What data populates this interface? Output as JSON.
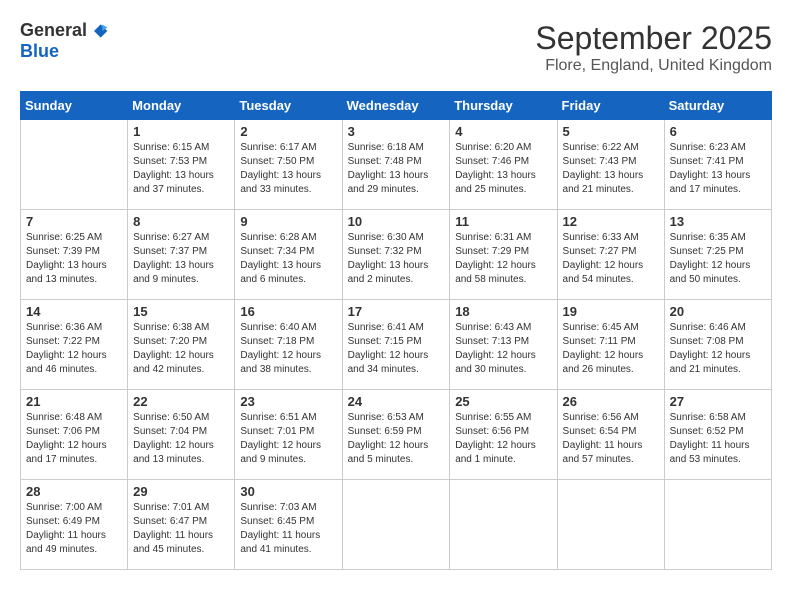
{
  "logo": {
    "general": "General",
    "blue": "Blue"
  },
  "title": "September 2025",
  "location": "Flore, England, United Kingdom",
  "days_header": [
    "Sunday",
    "Monday",
    "Tuesday",
    "Wednesday",
    "Thursday",
    "Friday",
    "Saturday"
  ],
  "weeks": [
    [
      {
        "day": "",
        "info": ""
      },
      {
        "day": "1",
        "info": "Sunrise: 6:15 AM\nSunset: 7:53 PM\nDaylight: 13 hours\nand 37 minutes."
      },
      {
        "day": "2",
        "info": "Sunrise: 6:17 AM\nSunset: 7:50 PM\nDaylight: 13 hours\nand 33 minutes."
      },
      {
        "day": "3",
        "info": "Sunrise: 6:18 AM\nSunset: 7:48 PM\nDaylight: 13 hours\nand 29 minutes."
      },
      {
        "day": "4",
        "info": "Sunrise: 6:20 AM\nSunset: 7:46 PM\nDaylight: 13 hours\nand 25 minutes."
      },
      {
        "day": "5",
        "info": "Sunrise: 6:22 AM\nSunset: 7:43 PM\nDaylight: 13 hours\nand 21 minutes."
      },
      {
        "day": "6",
        "info": "Sunrise: 6:23 AM\nSunset: 7:41 PM\nDaylight: 13 hours\nand 17 minutes."
      }
    ],
    [
      {
        "day": "7",
        "info": "Sunrise: 6:25 AM\nSunset: 7:39 PM\nDaylight: 13 hours\nand 13 minutes."
      },
      {
        "day": "8",
        "info": "Sunrise: 6:27 AM\nSunset: 7:37 PM\nDaylight: 13 hours\nand 9 minutes."
      },
      {
        "day": "9",
        "info": "Sunrise: 6:28 AM\nSunset: 7:34 PM\nDaylight: 13 hours\nand 6 minutes."
      },
      {
        "day": "10",
        "info": "Sunrise: 6:30 AM\nSunset: 7:32 PM\nDaylight: 13 hours\nand 2 minutes."
      },
      {
        "day": "11",
        "info": "Sunrise: 6:31 AM\nSunset: 7:29 PM\nDaylight: 12 hours\nand 58 minutes."
      },
      {
        "day": "12",
        "info": "Sunrise: 6:33 AM\nSunset: 7:27 PM\nDaylight: 12 hours\nand 54 minutes."
      },
      {
        "day": "13",
        "info": "Sunrise: 6:35 AM\nSunset: 7:25 PM\nDaylight: 12 hours\nand 50 minutes."
      }
    ],
    [
      {
        "day": "14",
        "info": "Sunrise: 6:36 AM\nSunset: 7:22 PM\nDaylight: 12 hours\nand 46 minutes."
      },
      {
        "day": "15",
        "info": "Sunrise: 6:38 AM\nSunset: 7:20 PM\nDaylight: 12 hours\nand 42 minutes."
      },
      {
        "day": "16",
        "info": "Sunrise: 6:40 AM\nSunset: 7:18 PM\nDaylight: 12 hours\nand 38 minutes."
      },
      {
        "day": "17",
        "info": "Sunrise: 6:41 AM\nSunset: 7:15 PM\nDaylight: 12 hours\nand 34 minutes."
      },
      {
        "day": "18",
        "info": "Sunrise: 6:43 AM\nSunset: 7:13 PM\nDaylight: 12 hours\nand 30 minutes."
      },
      {
        "day": "19",
        "info": "Sunrise: 6:45 AM\nSunset: 7:11 PM\nDaylight: 12 hours\nand 26 minutes."
      },
      {
        "day": "20",
        "info": "Sunrise: 6:46 AM\nSunset: 7:08 PM\nDaylight: 12 hours\nand 21 minutes."
      }
    ],
    [
      {
        "day": "21",
        "info": "Sunrise: 6:48 AM\nSunset: 7:06 PM\nDaylight: 12 hours\nand 17 minutes."
      },
      {
        "day": "22",
        "info": "Sunrise: 6:50 AM\nSunset: 7:04 PM\nDaylight: 12 hours\nand 13 minutes."
      },
      {
        "day": "23",
        "info": "Sunrise: 6:51 AM\nSunset: 7:01 PM\nDaylight: 12 hours\nand 9 minutes."
      },
      {
        "day": "24",
        "info": "Sunrise: 6:53 AM\nSunset: 6:59 PM\nDaylight: 12 hours\nand 5 minutes."
      },
      {
        "day": "25",
        "info": "Sunrise: 6:55 AM\nSunset: 6:56 PM\nDaylight: 12 hours\nand 1 minute."
      },
      {
        "day": "26",
        "info": "Sunrise: 6:56 AM\nSunset: 6:54 PM\nDaylight: 11 hours\nand 57 minutes."
      },
      {
        "day": "27",
        "info": "Sunrise: 6:58 AM\nSunset: 6:52 PM\nDaylight: 11 hours\nand 53 minutes."
      }
    ],
    [
      {
        "day": "28",
        "info": "Sunrise: 7:00 AM\nSunset: 6:49 PM\nDaylight: 11 hours\nand 49 minutes."
      },
      {
        "day": "29",
        "info": "Sunrise: 7:01 AM\nSunset: 6:47 PM\nDaylight: 11 hours\nand 45 minutes."
      },
      {
        "day": "30",
        "info": "Sunrise: 7:03 AM\nSunset: 6:45 PM\nDaylight: 11 hours\nand 41 minutes."
      },
      {
        "day": "",
        "info": ""
      },
      {
        "day": "",
        "info": ""
      },
      {
        "day": "",
        "info": ""
      },
      {
        "day": "",
        "info": ""
      }
    ]
  ]
}
